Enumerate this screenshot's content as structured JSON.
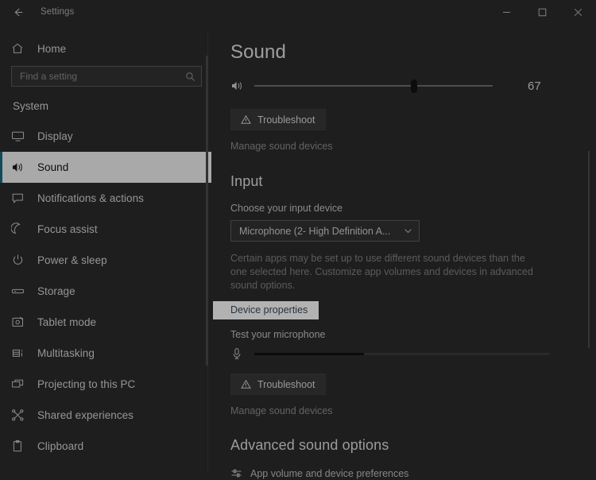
{
  "window": {
    "title": "Settings",
    "back_icon": "back-arrow-icon",
    "minimize_label": "–",
    "maximize_label": "□",
    "close_label": "✕"
  },
  "sidebar": {
    "home_label": "Home",
    "home_icon": "home-icon",
    "search": {
      "placeholder": "Find a setting",
      "value": "",
      "icon": "search-icon"
    },
    "section_label": "System",
    "selected_index": 1,
    "accent_color": "#1b6b80",
    "selected_bg": "#f2f2f2",
    "items": [
      {
        "label": "Display",
        "icon": "monitor-icon"
      },
      {
        "label": "Sound",
        "icon": "speaker-icon"
      },
      {
        "label": "Notifications & actions",
        "icon": "notification-icon"
      },
      {
        "label": "Focus assist",
        "icon": "moon-icon"
      },
      {
        "label": "Power & sleep",
        "icon": "power-icon"
      },
      {
        "label": "Storage",
        "icon": "storage-icon"
      },
      {
        "label": "Tablet mode",
        "icon": "tablet-icon"
      },
      {
        "label": "Multitasking",
        "icon": "multitasking-icon"
      },
      {
        "label": "Projecting to this PC",
        "icon": "project-icon"
      },
      {
        "label": "Shared experiences",
        "icon": "share-icon"
      },
      {
        "label": "Clipboard",
        "icon": "clipboard-icon"
      }
    ]
  },
  "main": {
    "page_title": "Sound",
    "volume": {
      "icon": "speaker-volume-icon",
      "value": "67",
      "percent": 67
    },
    "output_troubleshoot_label": "Troubleshoot",
    "output_manage_label": "Manage sound devices",
    "input": {
      "heading": "Input",
      "choose_label": "Choose your input device",
      "device_value": "Microphone (2- High Definition A...",
      "chevron_icon": "chevron-down-icon",
      "helper_text": "Certain apps may be set up to use different sound devices than the one selected here. Customize app volumes and devices in advanced sound options.",
      "device_properties_label": "Device properties",
      "device_properties_highlight_bg": "#ffffff",
      "device_properties_text_color": "#3b4a59",
      "test_mic_label": "Test your microphone",
      "mic_icon": "microphone-icon",
      "mic_level_percent": 37,
      "troubleshoot_label": "Troubleshoot",
      "manage_label": "Manage sound devices",
      "warning_icon": "warning-triangle-icon"
    },
    "advanced": {
      "heading": "Advanced sound options",
      "app_volume_label": "App volume and device preferences",
      "app_volume_icon": "mixer-icon"
    }
  }
}
